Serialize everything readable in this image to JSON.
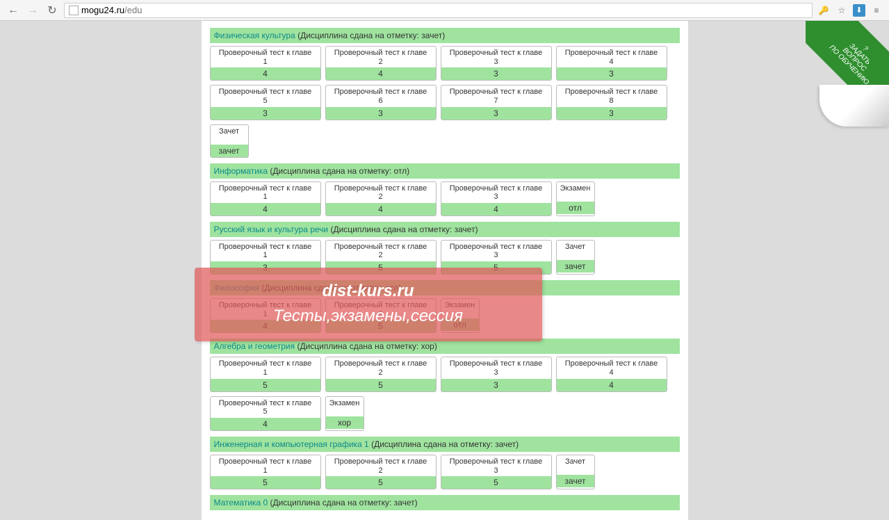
{
  "browser": {
    "url_domain": "mogu24.ru",
    "url_path": "/edu"
  },
  "corner": {
    "line1": "ЗАДАТЬ",
    "line2": "ВОПРОС",
    "line3": "ПО ОБУЧЕНИЮ",
    "qmark": "?"
  },
  "watermark": {
    "line1": "dist-kurs.ru",
    "line2": "Тесты,экзамены,сессия"
  },
  "status_prefix": "(Дисциплина сдана на отметку: ",
  "status_suffix": ")",
  "test_label": "Проверочный тест к главе",
  "exam_label": "Экзамен",
  "zachet_label": "Зачет",
  "subjects": [
    {
      "name": "Физическая культура",
      "grade": "зачет",
      "tests": [
        {
          "n": "1",
          "score": "4"
        },
        {
          "n": "2",
          "score": "4"
        },
        {
          "n": "3",
          "score": "3"
        },
        {
          "n": "4",
          "score": "3"
        },
        {
          "n": "5",
          "score": "3"
        },
        {
          "n": "6",
          "score": "3"
        },
        {
          "n": "7",
          "score": "3"
        },
        {
          "n": "8",
          "score": "3"
        }
      ],
      "extras": [
        {
          "type": "zachet",
          "score": "зачет"
        }
      ]
    },
    {
      "name": "Информатика",
      "grade": "отл",
      "tests": [
        {
          "n": "1",
          "score": "4"
        },
        {
          "n": "2",
          "score": "4"
        },
        {
          "n": "3",
          "score": "4"
        }
      ],
      "extras": [
        {
          "type": "exam",
          "score": "отл"
        }
      ]
    },
    {
      "name": "Русский язык и культура речи",
      "grade": "зачет",
      "tests": [
        {
          "n": "1",
          "score": "3"
        },
        {
          "n": "2",
          "score": "5"
        },
        {
          "n": "3",
          "score": "5"
        }
      ],
      "extras": [
        {
          "type": "zachet",
          "score": "зачет"
        }
      ]
    },
    {
      "name": "Философия",
      "grade": "отл",
      "tests": [
        {
          "n": "1",
          "score": "4"
        },
        {
          "n": "2",
          "score": "5"
        }
      ],
      "extras": [
        {
          "type": "exam",
          "score": "отл"
        }
      ]
    },
    {
      "name": "Алгебра и геометрия",
      "grade": "хор",
      "tests": [
        {
          "n": "1",
          "score": "5"
        },
        {
          "n": "2",
          "score": "5"
        },
        {
          "n": "3",
          "score": "3"
        },
        {
          "n": "4",
          "score": "4"
        },
        {
          "n": "5",
          "score": "4"
        }
      ],
      "extras": [
        {
          "type": "exam",
          "score": "хор"
        }
      ]
    },
    {
      "name": "Инженерная и компьютерная графика 1",
      "grade": "зачет",
      "tests": [
        {
          "n": "1",
          "score": "5"
        },
        {
          "n": "2",
          "score": "5"
        },
        {
          "n": "3",
          "score": "5"
        }
      ],
      "extras": [
        {
          "type": "zachet",
          "score": "зачет"
        }
      ]
    },
    {
      "name": "Математика 0",
      "grade": "зачет",
      "tests": [],
      "extras": []
    }
  ]
}
